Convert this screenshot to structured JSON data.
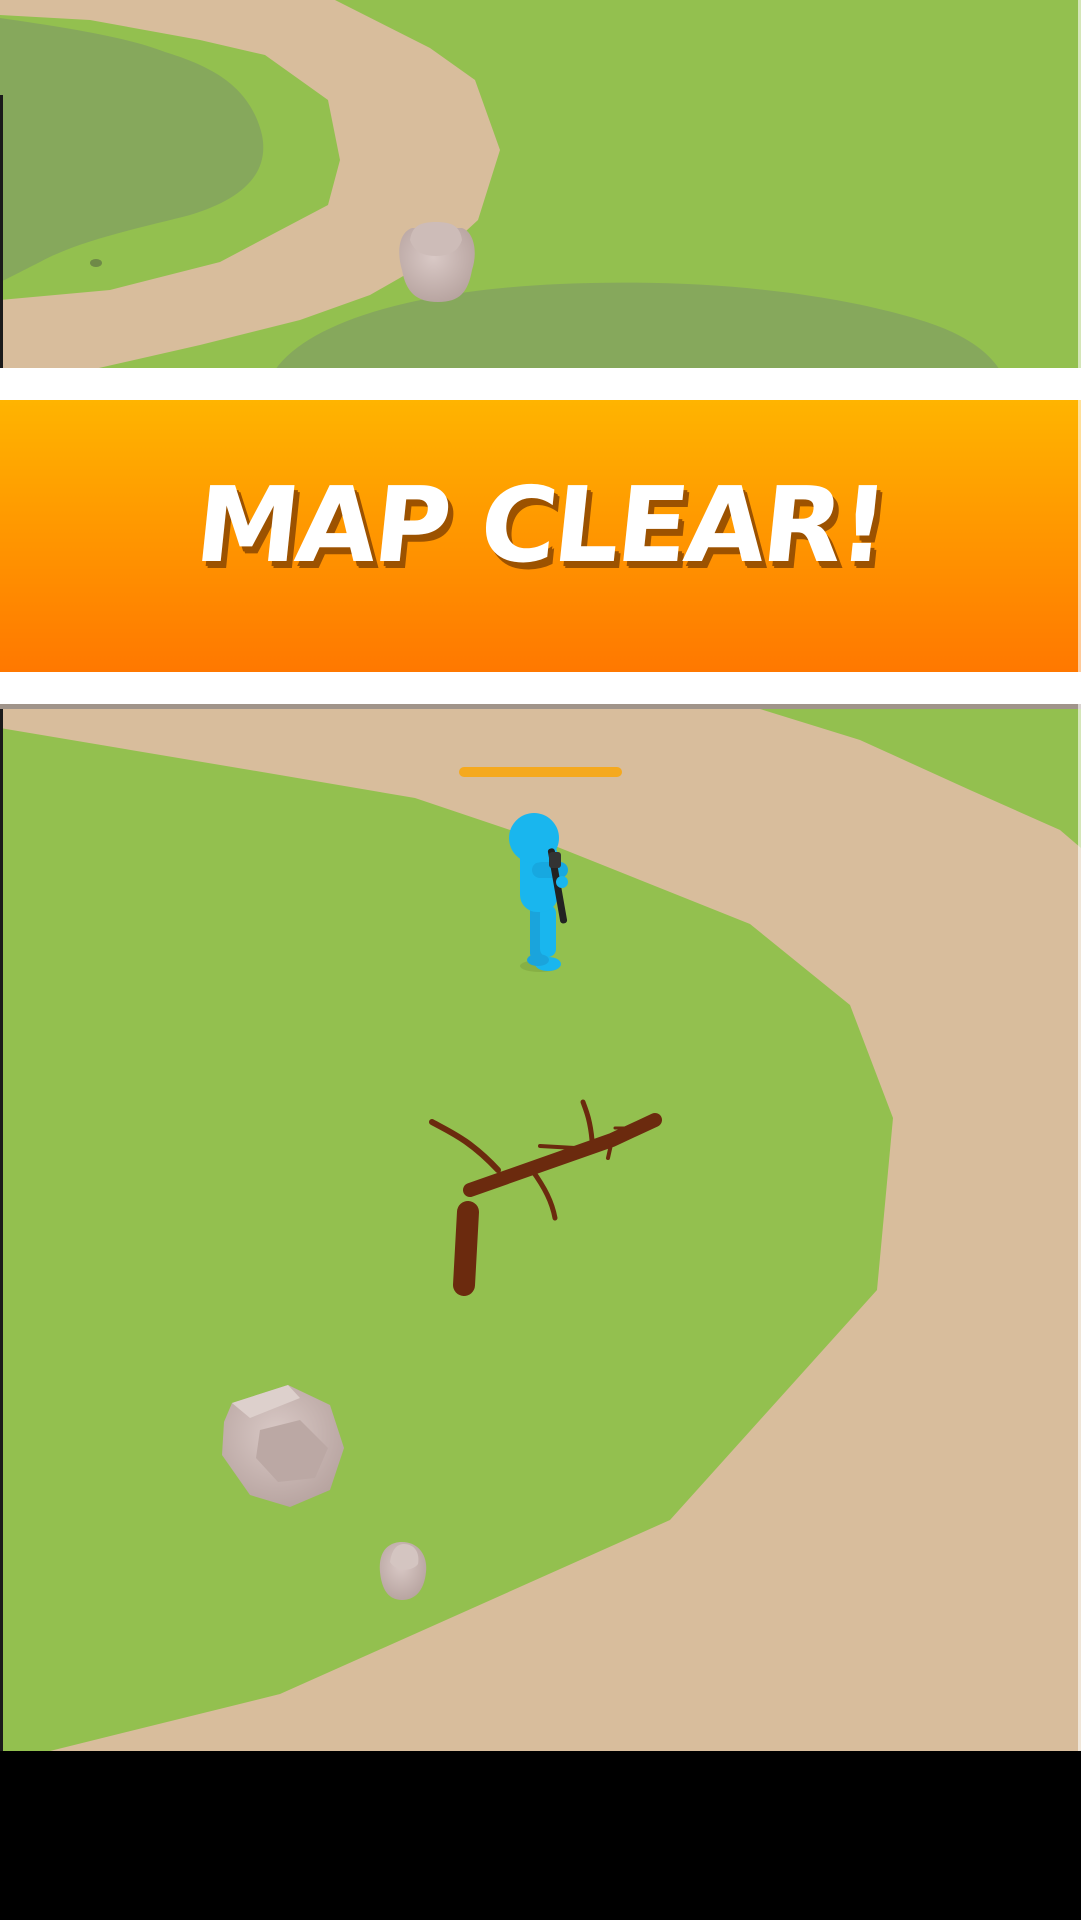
{
  "banner": {
    "title": "MAP CLEAR!"
  },
  "player": {
    "health_fraction": 1.0
  },
  "colors": {
    "grass": "#93c04f",
    "grass_dark": "#86a85c",
    "path": "#d8bd9c",
    "player": "#19b6ee",
    "wood": "#6b2a0e",
    "rock": "#c7b4b0",
    "banner_top": "#ffb400",
    "banner_bottom": "#ff7800",
    "banner_stripe": "#ffffff",
    "health_bar": "#f5a91e",
    "bottom_bar": "#000000"
  }
}
